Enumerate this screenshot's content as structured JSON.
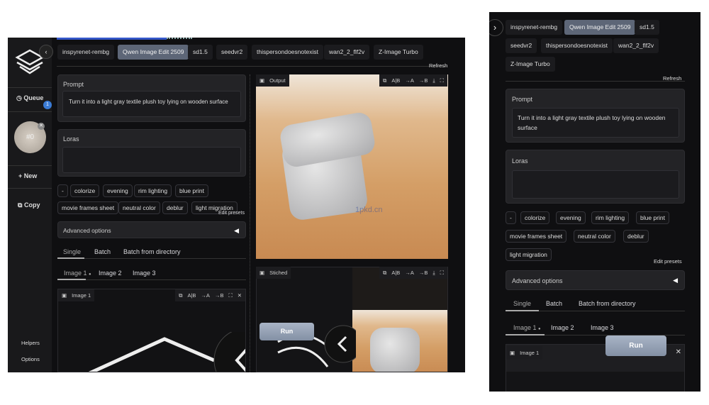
{
  "sidebar": {
    "queue": "Queue",
    "queue_count": "1",
    "job": "#0",
    "new": "New",
    "copy": "Copy",
    "helpers": "Helpers",
    "options": "Options"
  },
  "workflows": [
    "inspyrenet-rembg",
    "Qwen Image Edit 2509",
    "sd1.5",
    "seedvr2",
    "thispersondoesnotexist",
    "wan2_2_flf2v",
    "Z-Image Turbo"
  ],
  "refresh": "Refresh",
  "prompt": {
    "label": "Prompt",
    "value": "Turn it into a light gray textile plush toy lying on wooden surface"
  },
  "loras": {
    "label": "Loras",
    "value": ""
  },
  "presets": [
    "-",
    "colorize",
    "evening",
    "rim lighting",
    "blue print",
    "movie frames sheet",
    "neutral color",
    "deblur",
    "light migration"
  ],
  "edit_presets": "Edit presets",
  "advanced": "Advanced options",
  "mode_tabs": [
    "Single",
    "Batch",
    "Batch from directory"
  ],
  "image_tabs": [
    "Image 1",
    "Image 2",
    "Image 3"
  ],
  "image1_label": "Image 1",
  "output_label": "Output",
  "stitched_label": "Stiched",
  "toolbar": {
    "ab": "A|B",
    "to_a": "→A",
    "to_b": "→B",
    "download": "⤓",
    "fullscreen": "⛶",
    "close": "✕"
  },
  "run": "Run",
  "watermark": "1pkd.cn"
}
